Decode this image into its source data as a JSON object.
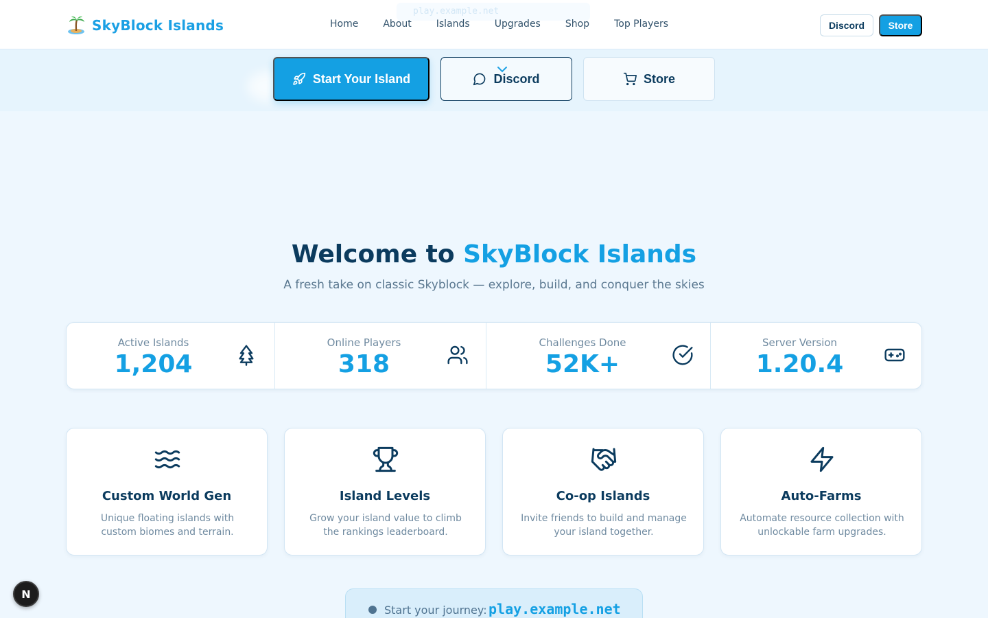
{
  "navbar": {
    "brand_name": "SkyBlock Islands",
    "ghost_text": "play.example.net",
    "links": [
      "Home",
      "About",
      "Islands",
      "Upgrades",
      "Shop",
      "Top Players"
    ],
    "discord_label": "Discord",
    "store_label": "Store"
  },
  "hero": {
    "start_label": "Start Your Island",
    "discord_label": "Discord",
    "store_label": "Store"
  },
  "welcome": {
    "title_prefix": "Welcome to ",
    "title_highlight": "SkyBlock Islands",
    "subtitle": "A fresh take on classic Skyblock — explore, build, and conquer the skies"
  },
  "stats": [
    {
      "label": "Active Islands",
      "value": "1,204",
      "icon": "tree-icon"
    },
    {
      "label": "Online Players",
      "value": "318",
      "icon": "users-icon"
    },
    {
      "label": "Challenges Done",
      "value": "52K+",
      "icon": "check-circle-icon"
    },
    {
      "label": "Server Version",
      "value": "1.20.4",
      "icon": "gamepad-icon"
    }
  ],
  "features": [
    {
      "title": "Custom World Gen",
      "desc": "Unique floating islands with custom biomes and terrain.",
      "icon": "waves-icon"
    },
    {
      "title": "Island Levels",
      "desc": "Grow your island value to climb the rankings leaderboard.",
      "icon": "trophy-icon"
    },
    {
      "title": "Co-op Islands",
      "desc": "Invite friends to build and manage your island together.",
      "icon": "handshake-icon"
    },
    {
      "title": "Auto-Farms",
      "desc": "Automate resource collection with unlockable farm upgrades.",
      "icon": "lightning-icon"
    }
  ],
  "journey": {
    "label": "Start your journey:",
    "address": "play.example.net"
  },
  "dev_badge": "N",
  "colors": {
    "accent": "#14a0e3",
    "navy": "#0b3b5e",
    "background": "#eef7fe"
  }
}
